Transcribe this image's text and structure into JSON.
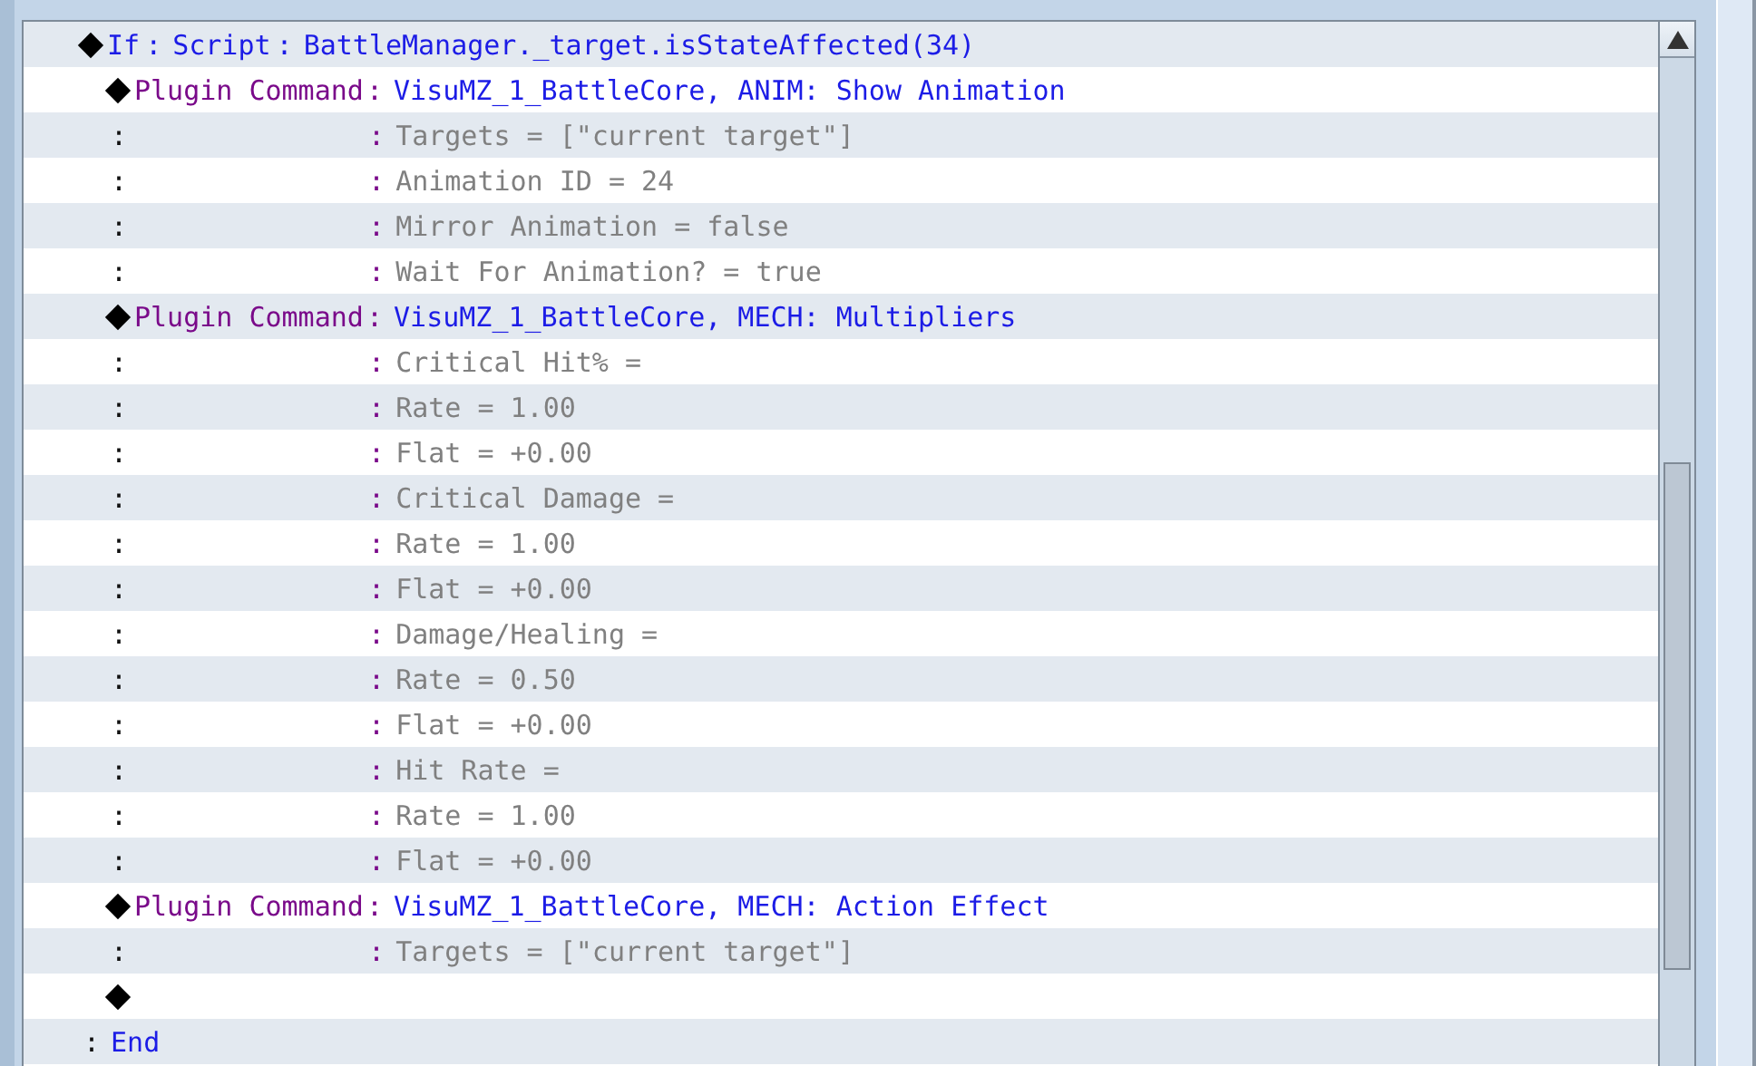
{
  "contents": {
    "rows": [
      {
        "kind": "if",
        "label": "If",
        "sep": ":",
        "source": "Script",
        "sep2": ":",
        "text": "BattleManager._target.isStateAffected(34)",
        "children": [
          {
            "kind": "command",
            "name": "Plugin Command",
            "sep": ":",
            "text": "VisuMZ_1_BattleCore, ANIM: Show Animation",
            "children": [
              {
                "kind": "param",
                "marker": ":",
                "sep": ":",
                "text": "Targets = [\"current target\"]"
              },
              {
                "kind": "param",
                "marker": ":",
                "sep": ":",
                "text": "Animation ID = 24"
              },
              {
                "kind": "param",
                "marker": ":",
                "sep": ":",
                "text": "Mirror Animation = false"
              },
              {
                "kind": "param",
                "marker": ":",
                "sep": ":",
                "text": "Wait For Animation? = true"
              }
            ]
          },
          {
            "kind": "command",
            "name": "Plugin Command",
            "sep": ":",
            "text": "VisuMZ_1_BattleCore, MECH: Multipliers",
            "children": [
              {
                "kind": "param",
                "marker": ":",
                "sep": ":",
                "text": "Critical Hit% ="
              },
              {
                "kind": "param",
                "marker": ":",
                "sep": ":",
                "text": "Rate = 1.00"
              },
              {
                "kind": "param",
                "marker": ":",
                "sep": ":",
                "text": "Flat = +0.00"
              },
              {
                "kind": "param",
                "marker": ":",
                "sep": ":",
                "text": "Critical Damage ="
              },
              {
                "kind": "param",
                "marker": ":",
                "sep": ":",
                "text": "Rate = 1.00"
              },
              {
                "kind": "param",
                "marker": ":",
                "sep": ":",
                "text": "Flat = +0.00"
              },
              {
                "kind": "param",
                "marker": ":",
                "sep": ":",
                "text": "Damage/Healing ="
              },
              {
                "kind": "param",
                "marker": ":",
                "sep": ":",
                "text": "Rate = 0.50"
              },
              {
                "kind": "param",
                "marker": ":",
                "sep": ":",
                "text": "Flat = +0.00"
              },
              {
                "kind": "param",
                "marker": ":",
                "sep": ":",
                "text": "Hit Rate ="
              },
              {
                "kind": "param",
                "marker": ":",
                "sep": ":",
                "text": "Rate = 1.00"
              },
              {
                "kind": "param",
                "marker": ":",
                "sep": ":",
                "text": "Flat = +0.00"
              }
            ]
          },
          {
            "kind": "command",
            "name": "Plugin Command",
            "sep": ":",
            "text": "VisuMZ_1_BattleCore, MECH: Action Effect",
            "children": [
              {
                "kind": "param",
                "marker": ":",
                "sep": ":",
                "text": "Targets = [\"current target\"]"
              }
            ]
          },
          {
            "kind": "empty"
          }
        ]
      },
      {
        "kind": "end",
        "sep": ":",
        "label": "End"
      }
    ]
  }
}
